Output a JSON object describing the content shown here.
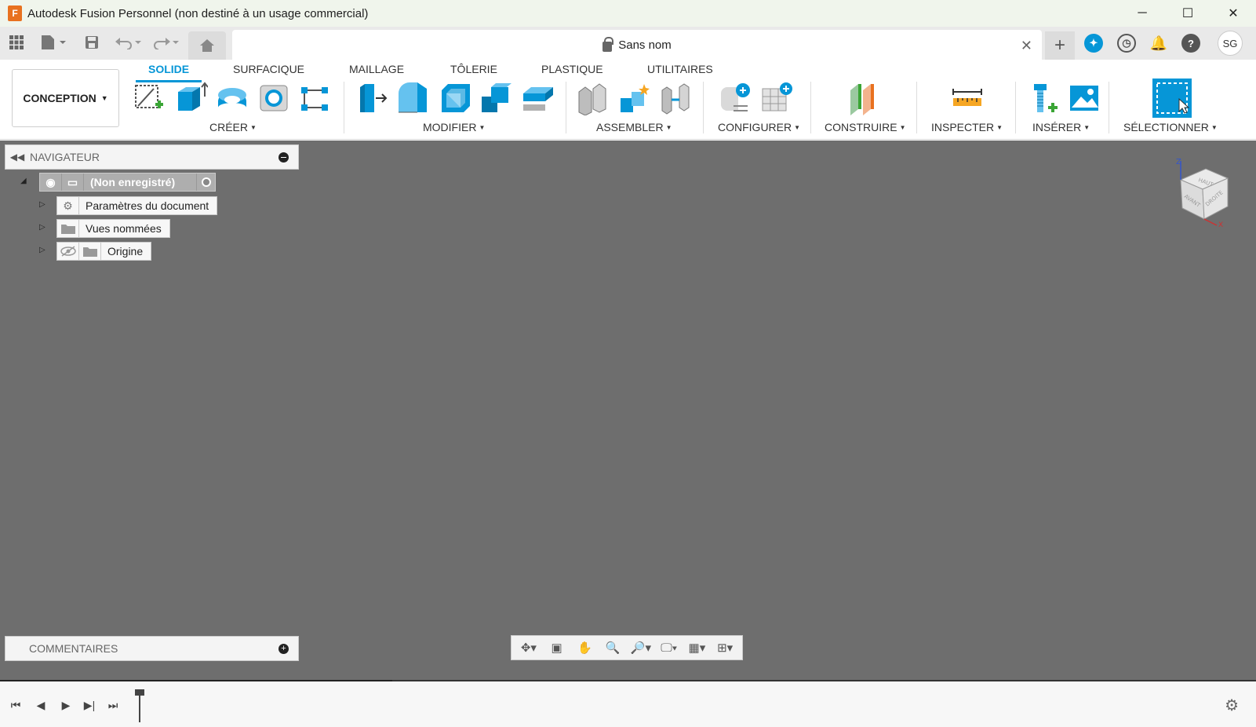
{
  "window": {
    "title": "Autodesk Fusion Personnel (non destiné à un usage commercial)",
    "logo_letter": "F",
    "minimize": "─",
    "maximize": "☐",
    "close": "✕"
  },
  "quick_access": {
    "doc_tab_title": "Sans nom",
    "doc_close": "✕",
    "new_tab": "+",
    "user_initials": "SG",
    "icons": [
      "apps-grid-icon",
      "file-menu-icon",
      "save-icon",
      "undo-icon",
      "redo-icon",
      "home-icon",
      "extensions-icon",
      "job-status-icon",
      "notifications-icon",
      "help-icon"
    ]
  },
  "ribbon": {
    "workspace": "CONCEPTION",
    "tabs": [
      "SOLIDE",
      "SURFACIQUE",
      "MAILLAGE",
      "TÔLERIE",
      "PLASTIQUE",
      "UTILITAIRES"
    ],
    "active_tab": "SOLIDE",
    "groups": {
      "create": "CRÉER",
      "modify": "MODIFIER",
      "assemble": "ASSEMBLER",
      "configure": "CONFIGURER",
      "construct": "CONSTRUIRE",
      "inspect": "INSPECTER",
      "insert": "INSÉRER",
      "select": "SÉLECTIONNER"
    },
    "accent_color": "#0696d7"
  },
  "navigator": {
    "title": "NAVIGATEUR",
    "root": "(Non enregistré)",
    "items": [
      {
        "label": "Paramètres du document",
        "icon": "gear-icon"
      },
      {
        "label": "Vues nommées",
        "icon": "folder-icon"
      },
      {
        "label": "Origine",
        "icon": "folder-icon"
      }
    ]
  },
  "viewcube": {
    "top": "HAUT",
    "front": "AVANT",
    "right": "DROITE",
    "axis_z": "Z",
    "axis_x": "X"
  },
  "comments": {
    "title": "COMMENTAIRES"
  },
  "canvas_color": "#6e6e6e"
}
